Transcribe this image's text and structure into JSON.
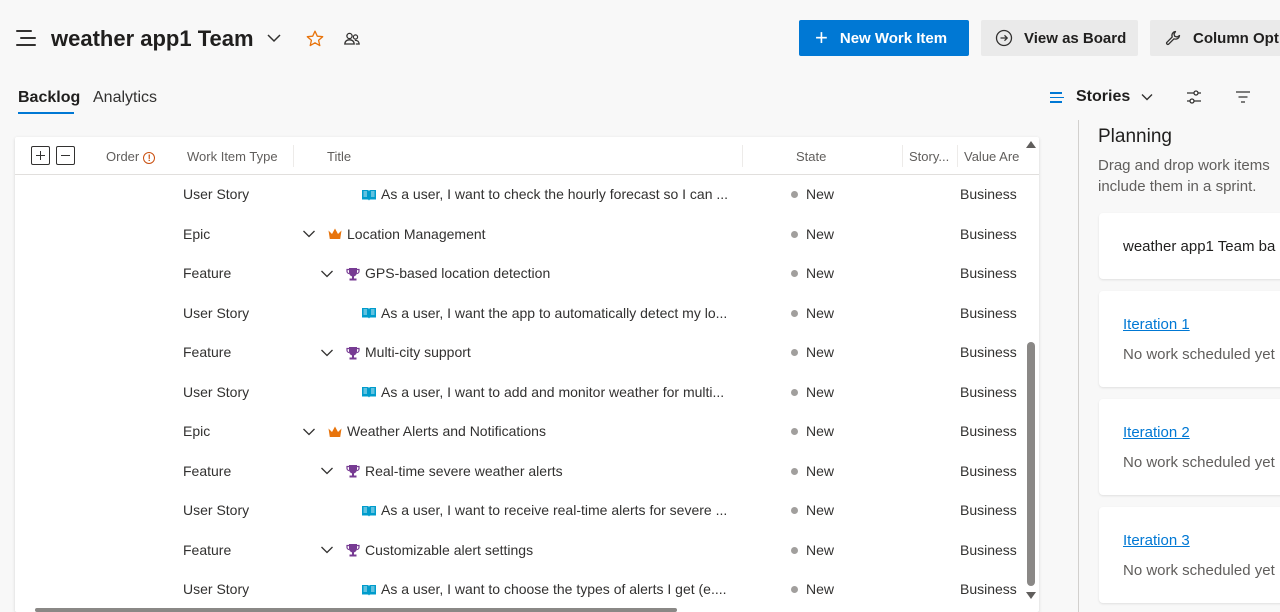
{
  "header": {
    "team_name": "weather app1 Team",
    "new_work_item_label": "New Work Item",
    "view_as_board_label": "View as Board",
    "column_options_label": "Column Opt"
  },
  "tabs": [
    {
      "label": "Backlog",
      "active": true
    },
    {
      "label": "Analytics",
      "active": false
    }
  ],
  "toolbar": {
    "level_label": "Stories"
  },
  "grid": {
    "columns": {
      "order": "Order",
      "type": "Work Item Type",
      "title": "Title",
      "state": "State",
      "story_points": "Story...",
      "value_area": "Value Are"
    },
    "rows": [
      {
        "type": "User Story",
        "title": "As a user, I want to check the hourly forecast so I can ...",
        "state": "New",
        "area": "Business",
        "kind": "story",
        "level": 2
      },
      {
        "type": "Epic",
        "title": "Location Management",
        "state": "New",
        "area": "Business",
        "kind": "epic",
        "level": 0
      },
      {
        "type": "Feature",
        "title": "GPS-based location detection",
        "state": "New",
        "area": "Business",
        "kind": "feature",
        "level": 1
      },
      {
        "type": "User Story",
        "title": "As a user, I want the app to automatically detect my lo...",
        "state": "New",
        "area": "Business",
        "kind": "story",
        "level": 2
      },
      {
        "type": "Feature",
        "title": "Multi-city support",
        "state": "New",
        "area": "Business",
        "kind": "feature",
        "level": 1
      },
      {
        "type": "User Story",
        "title": "As a user, I want to add and monitor weather for multi...",
        "state": "New",
        "area": "Business",
        "kind": "story",
        "level": 2
      },
      {
        "type": "Epic",
        "title": "Weather Alerts and Notifications",
        "state": "New",
        "area": "Business",
        "kind": "epic",
        "level": 0
      },
      {
        "type": "Feature",
        "title": "Real-time severe weather alerts",
        "state": "New",
        "area": "Business",
        "kind": "feature",
        "level": 1
      },
      {
        "type": "User Story",
        "title": "As a user, I want to receive real-time alerts for severe ...",
        "state": "New",
        "area": "Business",
        "kind": "story",
        "level": 2
      },
      {
        "type": "Feature",
        "title": "Customizable alert settings",
        "state": "New",
        "area": "Business",
        "kind": "feature",
        "level": 1
      },
      {
        "type": "User Story",
        "title": "As a user, I want to choose the types of alerts I get (e....",
        "state": "New",
        "area": "Business",
        "kind": "story",
        "level": 2
      }
    ]
  },
  "planning": {
    "title": "Planning",
    "subtitle_line1": "Drag and drop work items",
    "subtitle_line2": "include them in a sprint.",
    "backlog_card": "weather app1 Team ba",
    "iterations": [
      {
        "name": "Iteration 1",
        "status": "No work scheduled yet"
      },
      {
        "name": "Iteration 2",
        "status": "No work scheduled yet"
      },
      {
        "name": "Iteration 3",
        "status": "No work scheduled yet"
      }
    ]
  },
  "colors": {
    "accent": "#0078d4",
    "epic": "#e8740c",
    "feature": "#773b93",
    "story": "#009ccc",
    "state_new": "#a19f9d"
  }
}
